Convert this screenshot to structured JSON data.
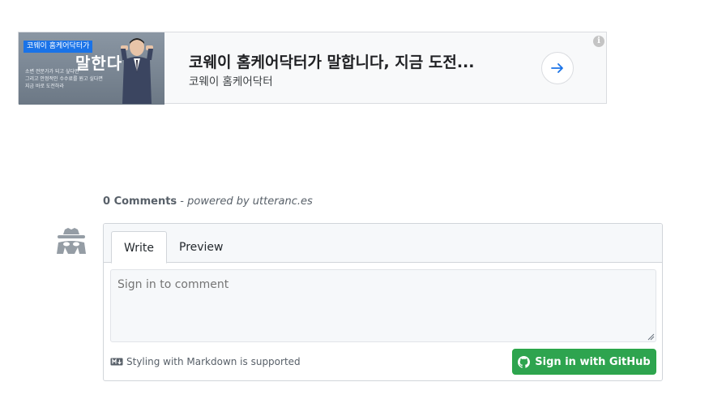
{
  "ad": {
    "title": "코웨이 홈케어닥터가 말합니다, 지금 도전...",
    "advertiser": "코웨이 홈케어닥터",
    "thumbnail": {
      "tag": "코웨이 홈케어닥터가",
      "headline": "말한다",
      "lines": [
        "소변 전문가가 되고 싶다면",
        "그리고 안정적인 수수료를 원고 싶다면",
        "지금 바로 도전하라"
      ]
    },
    "info_glyph": "i",
    "icons": {
      "arrow": "arrow-right-icon",
      "info": "info-icon"
    }
  },
  "comments": {
    "count_label": "0 Comments",
    "separator": " - ",
    "powered_by": "powered by utteranc.es"
  },
  "editor": {
    "tabs": [
      {
        "label": "Write",
        "active": true
      },
      {
        "label": "Preview",
        "active": false
      }
    ],
    "placeholder": "Sign in to comment",
    "markdown_note": "Styling with Markdown is supported",
    "signin_button": "Sign in with GitHub"
  },
  "colors": {
    "button_green": "#2ea44f",
    "ad_arrow": "#1a73e8",
    "border": "#d1d5da"
  }
}
